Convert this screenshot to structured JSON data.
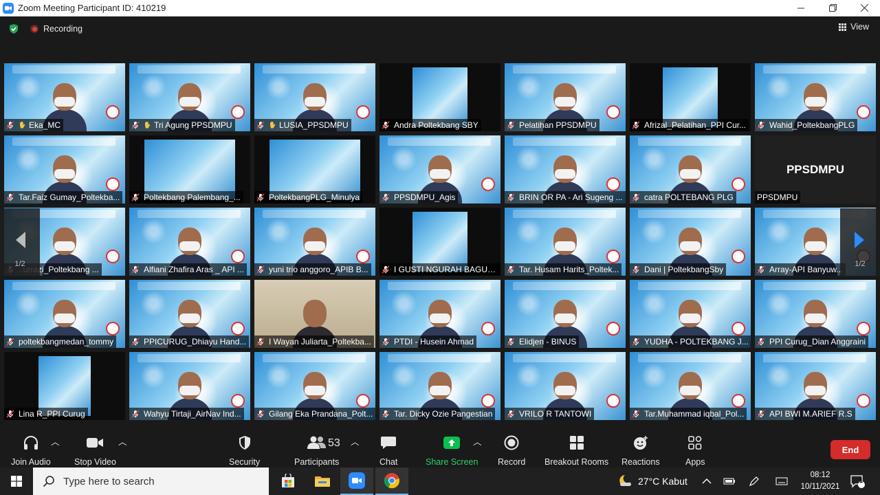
{
  "window": {
    "title": "Zoom Meeting Participant ID: 410219"
  },
  "topbar": {
    "recording_label": "Recording",
    "view_label": "View"
  },
  "pager": {
    "left_page": "1/2",
    "right_page": "1/2"
  },
  "grid": {
    "rows": [
      [
        {
          "name": "Eka_MC",
          "kind": "video",
          "hand": true
        },
        {
          "name": "Tri Agung PPSDMPU",
          "kind": "video",
          "hand": true
        },
        {
          "name": "LUSIA_PPSDMPU",
          "kind": "video",
          "hand": true
        },
        {
          "name": "Andra Poltekbang SBY",
          "kind": "dark"
        },
        {
          "name": "Pelatihan PPSDMPU",
          "kind": "video"
        },
        {
          "name": "Afrizal_Pelatihan_PPI Cur...",
          "kind": "dark"
        },
        {
          "name": "Wahid_PoltekbangPLG",
          "kind": "video"
        }
      ],
      [
        {
          "name": "Tar.Faiz Gumay_Poltekba...",
          "kind": "video"
        },
        {
          "name": "Poltekbang Palembang_...",
          "kind": "dark"
        },
        {
          "name": "PoltekbangPLG_Minulya",
          "kind": "dark"
        },
        {
          "name": "PPSDMPU_Agis",
          "kind": "video"
        },
        {
          "name": "BRIN OR PA - Ari Sugeng ...",
          "kind": "video"
        },
        {
          "name": "catra POLTEBANG PLG",
          "kind": "video"
        },
        {
          "name": "PPSDMPU",
          "kind": "blackname",
          "big": "PPSDMPU",
          "active": true
        }
      ],
      [
        {
          "name": "..urrazi_Poltekbang ...",
          "kind": "video"
        },
        {
          "name": "Alfiani Zhafira Aras _ API ...",
          "kind": "video"
        },
        {
          "name": "yuni trio anggoro_APIB B...",
          "kind": "video"
        },
        {
          "name": "I GUSTI NGURAH BAGUS ...",
          "kind": "dark"
        },
        {
          "name": "Tar. Husam Harits_Poltek...",
          "kind": "video"
        },
        {
          "name": "Dani | PoltekbangSby",
          "kind": "video"
        },
        {
          "name": "Array-API Banyuw...",
          "kind": "video"
        }
      ],
      [
        {
          "name": "poltekbangmedan_tommy",
          "kind": "video"
        },
        {
          "name": "PPICURUG_Dhiayu Hand...",
          "kind": "video"
        },
        {
          "name": "I Wayan Juliarta_Poltekba...",
          "kind": "room"
        },
        {
          "name": "PTDI - Husein Ahmad",
          "kind": "video"
        },
        {
          "name": "Elidjen - BINUS",
          "kind": "video"
        },
        {
          "name": "YUDHA - POLTEKBANG J...",
          "kind": "video"
        },
        {
          "name": "PPI Curug_Dian Anggraini",
          "kind": "video"
        }
      ],
      [
        {
          "name": "Lina R_PPI Curug",
          "kind": "dark"
        },
        {
          "name": "Wahyu Tirtaji_AirNav Ind...",
          "kind": "video"
        },
        {
          "name": "Gilang Eka Prandana_Polt...",
          "kind": "video"
        },
        {
          "name": "Tar. Dicky Ozie Pangestian",
          "kind": "video"
        },
        {
          "name": "VRILO R TANTOWI",
          "kind": "video"
        },
        {
          "name": "Tar.Muhammad iqbal_Pol...",
          "kind": "video"
        },
        {
          "name": "API BWI M.ARIEF R.S",
          "kind": "video"
        }
      ]
    ]
  },
  "toolbar": {
    "join_audio": "Join Audio",
    "stop_video": "Stop Video",
    "security": "Security",
    "participants": "Participants",
    "participants_count": "53",
    "chat": "Chat",
    "share_screen": "Share Screen",
    "record": "Record",
    "breakout_rooms": "Breakout Rooms",
    "reactions": "Reactions",
    "apps": "Apps",
    "end": "End"
  },
  "taskbar": {
    "search_placeholder": "Type here to search",
    "weather": "27°C  Kabut",
    "time": "08:12",
    "date": "10/11/2021",
    "notif_count": "1"
  },
  "colors": {
    "end_red": "#d42b2b",
    "share_green": "#0dbf4f",
    "active_border": "#e6ec6c",
    "zoom_blue": "#2d8cff"
  }
}
